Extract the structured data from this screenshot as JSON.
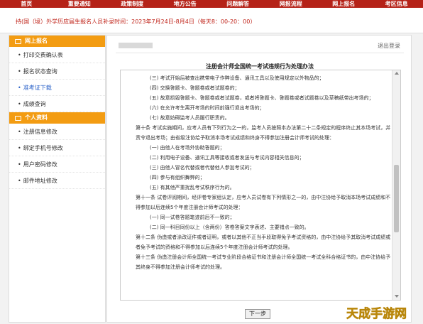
{
  "nav": {
    "items": [
      "首页",
      "重要通知",
      "政策制度",
      "地方公告",
      "问题解答",
      "网报流程",
      "网上报名",
      "考区信息"
    ]
  },
  "notice": {
    "text": "持(国（境）外学历应届生报名人员补录时间：2023年7月24日-8月4日（每天8：00-20：00）"
  },
  "sidebar": {
    "section1": "网上报名",
    "section1_items": [
      "打印交费确认表",
      "报名状态查询",
      "准考证下载",
      "成绩查询"
    ],
    "section2": "个人资料",
    "section2_items": [
      "注册信息修改",
      "绑定手机号修改",
      "用户密码修改",
      "邮件地址修改"
    ]
  },
  "main": {
    "logout": "退出登录",
    "doc_title": "注册会计师全国统一考试违规行为处理办法",
    "paragraphs": [
      "(三) 考试开始后被查出携带电子作弊设备、通讯工具以及使用规定以外物品的；",
      "(四) 交换答题卡、答题卷或者试题卷的；",
      "(五) 故意损毁答题卡、答题卷或者试题卷，或者将答题卡、答题卷或者试题卷以及草稿纸带出考场的；",
      "(六) 在允许考生离开考场的时间前强行退出考场的；",
      "(七) 故意妨碍监考人员履行职责的。",
      "第十条 考试实施期间，应考人员有下列行为之一的，监考人员按照本办法第二十二条规定的程序终止其本场考试，并责令退出考场；由省级注协给予取消本场考试成绩和终身不得参加注册会计师考试的处理：",
      "(一) 由他人在考场外协助答题的；",
      "(二) 利用电子设备、通讯工具等接收或者发送与考试内容相关信息的；",
      "(三) 由他人冒名代替或者代替他人参加考试的；",
      "(四) 参与有组织舞弊的；",
      "(五) 有其他严重扰乱考试秩序行为的。",
      "第十一条 试卷评阅期间，经评卷专家组认定，应考人员试卷有下列情形之一的，由中注协给予取消本场考试成绩和不得参加以后连续5个年度注册会计师考试的处理：",
      "(一) 同一试卷答题笔迹前后不一致的；",
      "(二) 同一科目同份以上（含两份）答卷答案文字表述、主要错点一致的。",
      "第十二条 伪造或者涂改证件或者证明，或者以其他不正当手段取得免予考试资格的，由中注协给予其取消考试成绩或者免予考试的资格和不得参加以后连续5个年度注册会计师考试的处理。",
      "第十三条 伪造注册会计师全国统一考试专业阶段合格证书和注册会计师全国统一考试全科合格证书的，由中注协给予其终身不得参加注册会计师考试的处理。"
    ],
    "next_button": "下一步"
  },
  "watermark": "天成手游网"
}
